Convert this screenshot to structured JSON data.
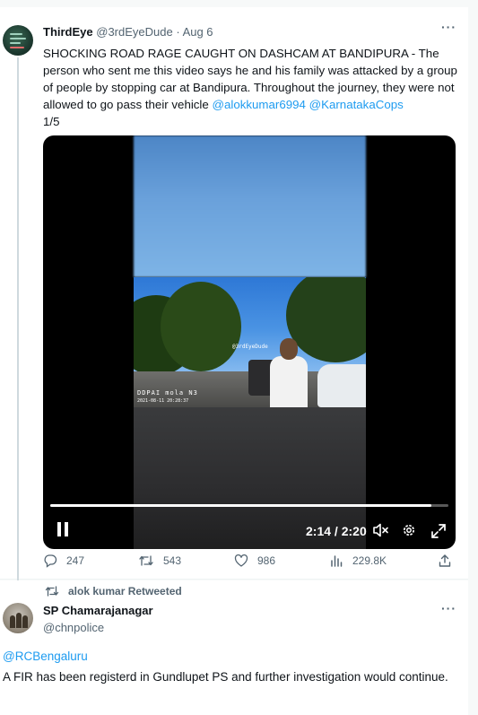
{
  "tweet1": {
    "display_name": "ThirdEye",
    "handle": "@3rdEyeDude",
    "separator": " · ",
    "date": "Aug 6",
    "more_label": "···",
    "text_before": "SHOCKING ROAD RAGE CAUGHT ON DASHCAM AT BANDIPURA - The person who sent me this video says he and his family was attacked by a group of people by stopping car at Bandipura. Throughout the journey, they were not allowed to go pass their vehicle ",
    "mention1": "@alokkumar6994",
    "mention2": "@KarnatakaCops",
    "text_after": "1/5",
    "video": {
      "watermark": "@3rdEyeDude",
      "stamp_brand": "DDPAI mola N3",
      "stamp_datetime": "2021-08-11  20:28:37",
      "current_time": "2:14",
      "duration": "2:20",
      "time_separator": " / ",
      "progress": 0.957
    },
    "actions": {
      "replies": "247",
      "retweets": "543",
      "likes": "986",
      "views": "229.8K"
    }
  },
  "retweet_label": "alok kumar Retweeted",
  "tweet2": {
    "display_name": "SP Chamarajanagar",
    "handle": "@chnpolice",
    "more_label": "···",
    "reply_mention": "@RCBengaluru",
    "text": "A FIR has been registerd in Gundlupet PS and further investigation would continue."
  },
  "colors": {
    "link": "#1d9bf0",
    "secondary_text": "#536471",
    "primary_text": "#0f1419"
  }
}
